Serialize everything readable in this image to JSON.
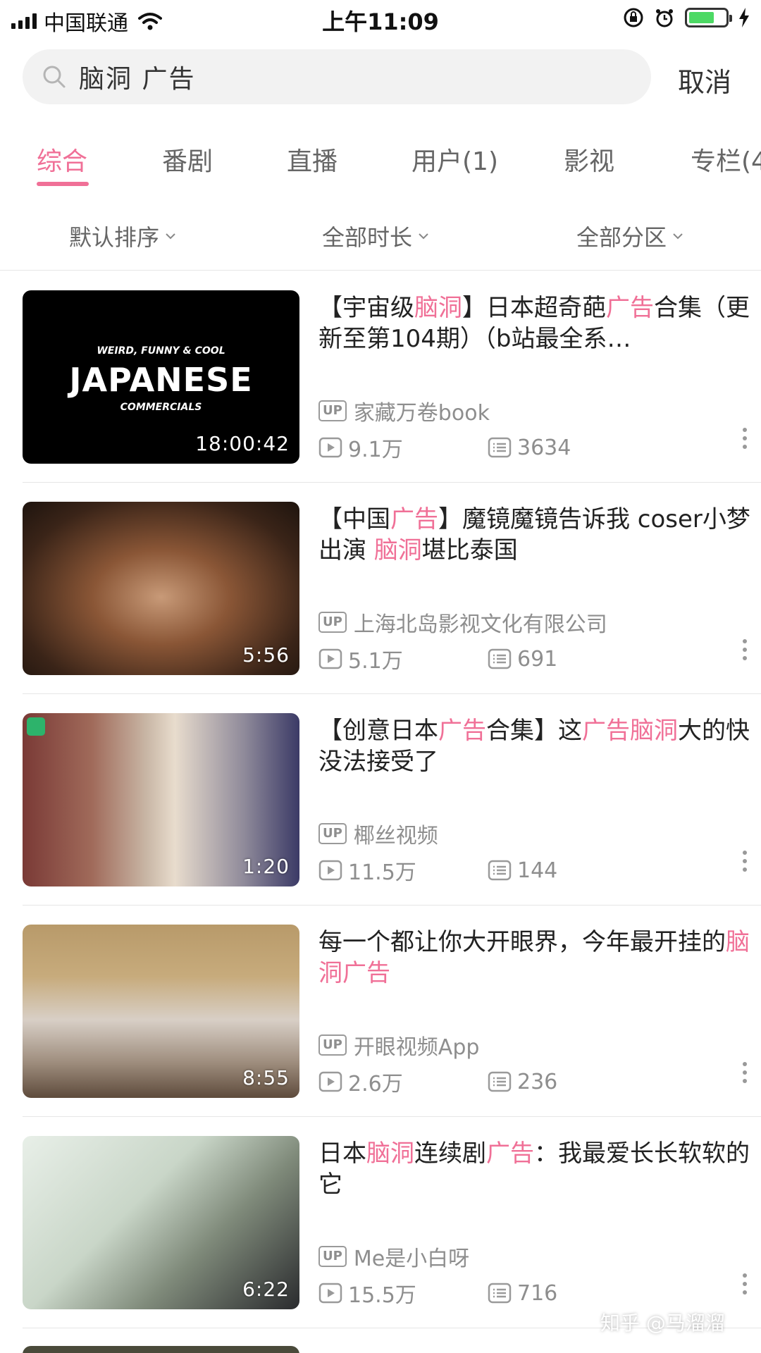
{
  "status_bar": {
    "carrier": "中国联通",
    "time": "上午11:09",
    "battery_level": 0.7
  },
  "search": {
    "query": "脑洞  广告",
    "cancel_label": "取消"
  },
  "tabs": [
    {
      "label": "综合",
      "active": true
    },
    {
      "label": "番剧",
      "active": false
    },
    {
      "label": "直播",
      "active": false
    },
    {
      "label": "用户(1)",
      "active": false
    },
    {
      "label": "影视",
      "active": false
    },
    {
      "label": "专栏(4",
      "active": false
    }
  ],
  "filters": [
    {
      "label": "默认排序"
    },
    {
      "label": "全部时长"
    },
    {
      "label": "全部分区"
    }
  ],
  "results": [
    {
      "title_parts": [
        {
          "text": "【宇宙级",
          "hl": false
        },
        {
          "text": "脑洞",
          "hl": true
        },
        {
          "text": "】日本超奇葩",
          "hl": false
        },
        {
          "text": "广告",
          "hl": true
        },
        {
          "text": "合集（更新至第104期）（b站最全系…",
          "hl": false
        }
      ],
      "thumb_text": {
        "top": "WEIRD, FUNNY & COOL",
        "main": "JAPANESE",
        "bottom": "COMMERCIALS"
      },
      "duration": "18:00:42",
      "uploader": "家藏万卷book",
      "plays": "9.1万",
      "danmaku": "3634"
    },
    {
      "title_parts": [
        {
          "text": "【中国",
          "hl": false
        },
        {
          "text": "广告",
          "hl": true
        },
        {
          "text": "】魔镜魔镜告诉我 coser小梦出演 ",
          "hl": false
        },
        {
          "text": "脑洞",
          "hl": true
        },
        {
          "text": "堪比泰国",
          "hl": false
        }
      ],
      "duration": "5:56",
      "uploader": "上海北岛影视文化有限公司",
      "plays": "5.1万",
      "danmaku": "691"
    },
    {
      "title_parts": [
        {
          "text": "【创意日本",
          "hl": false
        },
        {
          "text": "广告",
          "hl": true
        },
        {
          "text": "合集】这",
          "hl": false
        },
        {
          "text": "广告脑洞",
          "hl": true
        },
        {
          "text": "大的快没法接受了",
          "hl": false
        }
      ],
      "duration": "1:20",
      "uploader": "椰丝视频",
      "plays": "11.5万",
      "danmaku": "144"
    },
    {
      "title_parts": [
        {
          "text": "每一个都让你大开眼界，今年最开挂的",
          "hl": false
        },
        {
          "text": "脑洞广告",
          "hl": true
        }
      ],
      "duration": "8:55",
      "uploader": "开眼视频App",
      "plays": "2.6万",
      "danmaku": "236"
    },
    {
      "title_parts": [
        {
          "text": "日本",
          "hl": false
        },
        {
          "text": "脑洞",
          "hl": true
        },
        {
          "text": "连续剧",
          "hl": false
        },
        {
          "text": "广告",
          "hl": true
        },
        {
          "text": "：我最爱长长软软的它",
          "hl": false
        }
      ],
      "duration": "6:22",
      "uploader": "Me是小白呀",
      "plays": "15.5万",
      "danmaku": "716"
    }
  ],
  "up_badge": "UP",
  "watermark": "知乎 @马溜溜",
  "colors": {
    "accent": "#f07097",
    "muted": "#8e8e8e"
  }
}
